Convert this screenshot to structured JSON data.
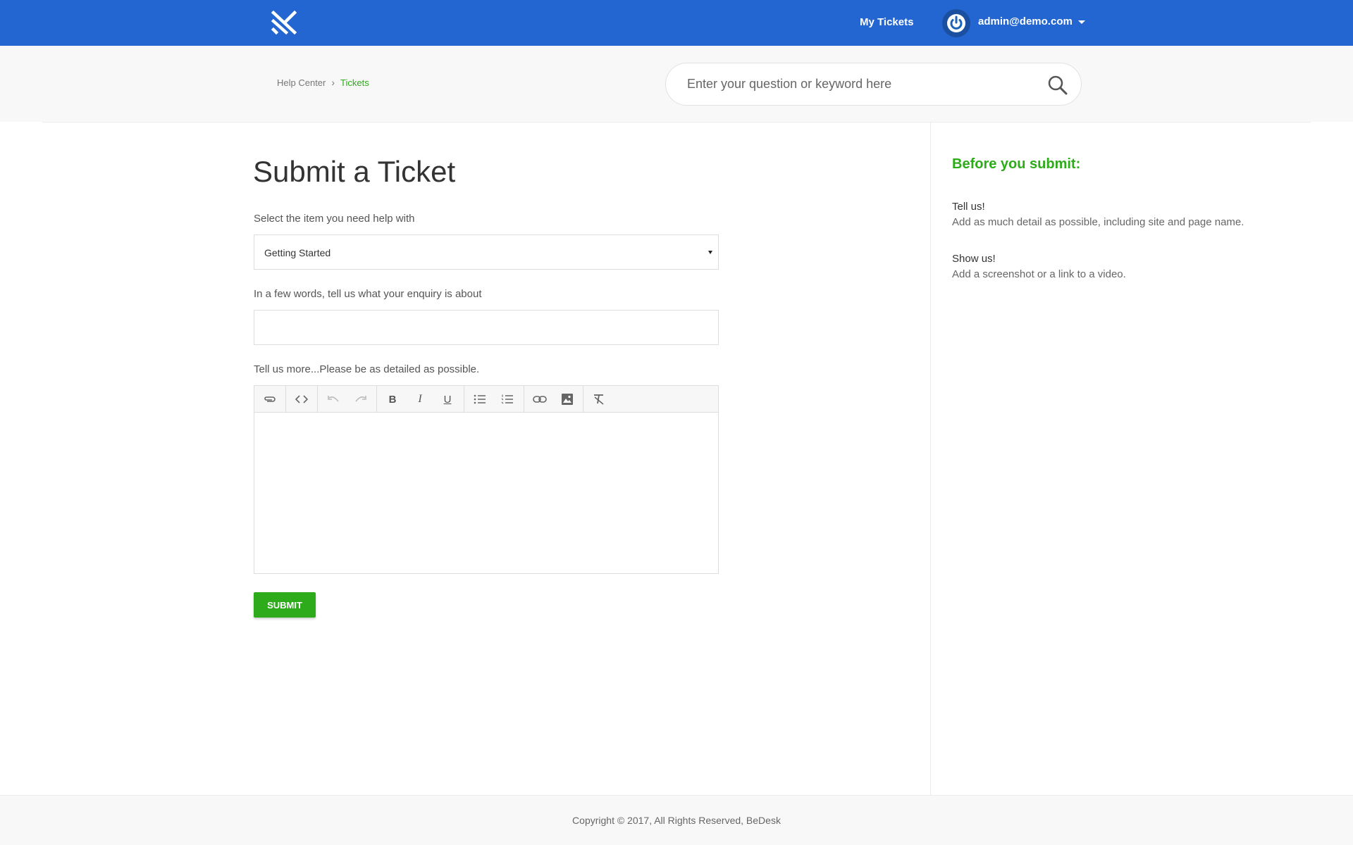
{
  "header": {
    "nav_my_tickets": "My Tickets",
    "user_email": "admin@demo.com"
  },
  "breadcrumb": {
    "home": "Help Center",
    "current": "Tickets"
  },
  "search": {
    "placeholder": "Enter your question or keyword here"
  },
  "form": {
    "title": "Submit a Ticket",
    "item_label": "Select the item you need help with",
    "item_value": "Getting Started",
    "subject_label": "In a few words, tell us what your enquiry is about",
    "subject_value": "",
    "details_label": "Tell us more...Please be as detailed as possible.",
    "toolbar_icons": [
      "attach-icon",
      "code-icon",
      "undo-icon",
      "redo-icon",
      "bold-icon",
      "italic-icon",
      "underline-icon",
      "bullet-list-icon",
      "numbered-list-icon",
      "link-icon",
      "image-icon",
      "clear-format-icon"
    ],
    "submit_label": "SUBMIT"
  },
  "sidebar": {
    "title": "Before you submit:",
    "tips": [
      {
        "heading": "Tell us!",
        "text": "Add as much detail as possible, including site and page name."
      },
      {
        "heading": "Show us!",
        "text": "Add a screenshot or a link to a video."
      }
    ]
  },
  "footer": {
    "copyright": "Copyright © 2017, All Rights Reserved,  BeDesk"
  },
  "colors": {
    "topbar": "#2366d1",
    "accent_green": "#2eab1b"
  }
}
